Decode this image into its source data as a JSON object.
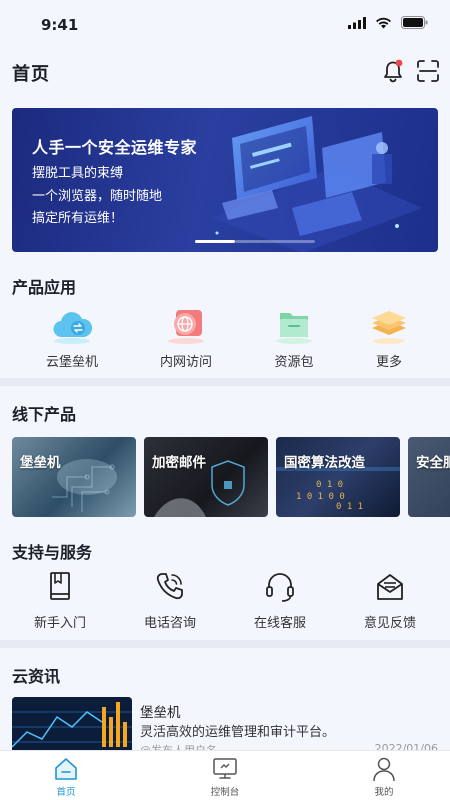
{
  "status_bar": {
    "time": "9:41"
  },
  "header": {
    "title": "首页"
  },
  "banner": {
    "title": "人手一个安全运维专家",
    "lines": [
      "摆脱工具的束缚",
      "一个浏览器，随时随地",
      "搞定所有运维！"
    ]
  },
  "product_apps": {
    "title": "产品应用",
    "items": [
      {
        "label": "云堡垒机",
        "icon": "cloud-exchange-icon"
      },
      {
        "label": "内网访问",
        "icon": "globe-network-icon"
      },
      {
        "label": "资源包",
        "icon": "folder-icon"
      },
      {
        "label": "更多",
        "icon": "layers-icon"
      }
    ]
  },
  "offline_products": {
    "title": "线下产品",
    "cards": [
      {
        "label": "堡垒机"
      },
      {
        "label": "加密邮件"
      },
      {
        "label": "国密算法改造"
      },
      {
        "label": "安全服"
      }
    ]
  },
  "support": {
    "title": "支持与服务",
    "items": [
      {
        "label": "新手入门",
        "icon": "book-icon"
      },
      {
        "label": "电话咨询",
        "icon": "phone-icon"
      },
      {
        "label": "在线客服",
        "icon": "headset-icon"
      },
      {
        "label": "意见反馈",
        "icon": "mail-icon"
      }
    ]
  },
  "news": {
    "title": "云资讯",
    "items": [
      {
        "title": "堡垒机",
        "desc": "灵活高效的运维管理和审计平台。",
        "author": "@发布人用户名",
        "date": "2022/01/06"
      }
    ]
  },
  "tab_bar": {
    "tabs": [
      {
        "label": "首页",
        "icon": "home-icon",
        "active": true
      },
      {
        "label": "控制台",
        "icon": "console-icon",
        "active": false
      },
      {
        "label": "我的",
        "icon": "user-icon",
        "active": false
      }
    ]
  },
  "colors": {
    "accent": "#1f95d6",
    "notification_dot": "#f04848",
    "banner_bg": "#2a3fa0"
  }
}
